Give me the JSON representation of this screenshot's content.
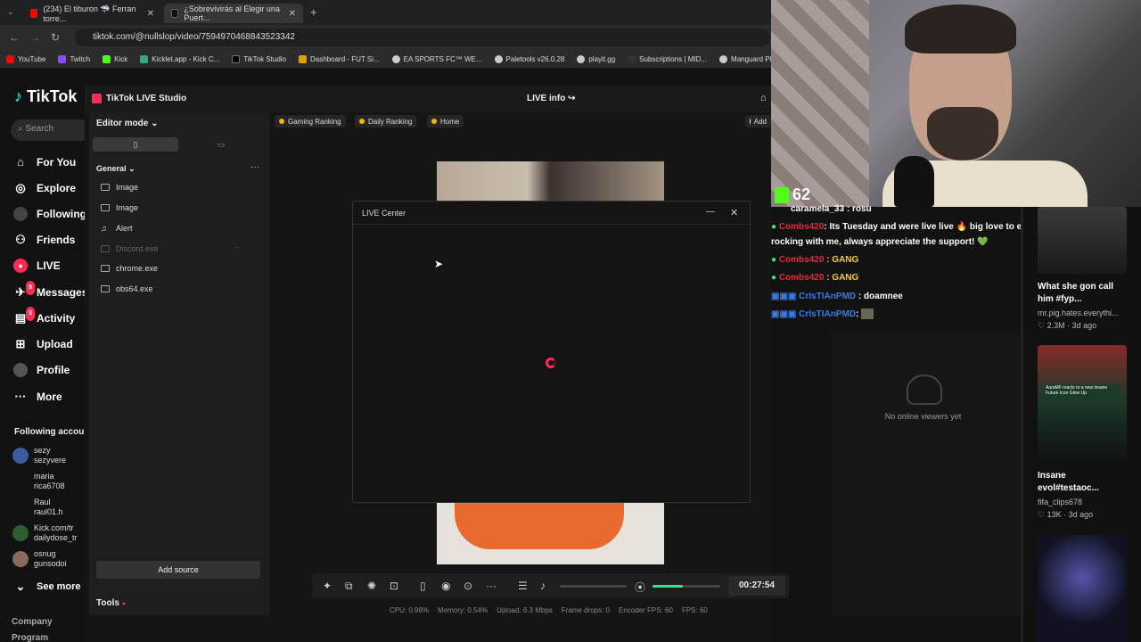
{
  "browser": {
    "tabs": [
      {
        "label": "(234) El tiburon 🦈 Ferran torre..."
      },
      {
        "label": "¿Sobrevivirás al Elegir una Puert..."
      }
    ],
    "url": "tiktok.com/@nullslop/video/7594970468843523342",
    "bookmarks": [
      "YouTube",
      "Twitch",
      "Kick",
      "Kicklet.app - Kick C...",
      "TikTok Studio",
      "Dashboard - FUT Si...",
      "EA SPORTS FC™ WE...",
      "Paletools v26.0.28",
      "playit.gg",
      "Subscriptions | MID...",
      "Manguard Plus"
    ]
  },
  "tiktok": {
    "logo": "TikTok",
    "search_placeholder": "Search",
    "nav": [
      {
        "label": "For You",
        "icon": "home-icon"
      },
      {
        "label": "Explore",
        "icon": "compass-icon"
      },
      {
        "label": "Following",
        "icon": "following-icon"
      },
      {
        "label": "Friends",
        "icon": "friends-icon"
      },
      {
        "label": "LIVE",
        "icon": "live-icon"
      },
      {
        "label": "Messages",
        "icon": "messages-icon",
        "badge": "9"
      },
      {
        "label": "Activity",
        "icon": "activity-icon",
        "badge": "3"
      },
      {
        "label": "Upload",
        "icon": "upload-icon"
      },
      {
        "label": "Profile",
        "icon": "profile-icon"
      },
      {
        "label": "More",
        "icon": "more-icon"
      }
    ],
    "following_header": "Following accoun",
    "following": [
      {
        "name": "sezy",
        "handle": "sezyvere"
      },
      {
        "name": "maria",
        "handle": "rica6708"
      },
      {
        "name": "Raul",
        "handle": "raul01.h"
      },
      {
        "name": "Kick.com/tr",
        "handle": "dailydose_tr"
      },
      {
        "name": "osnug",
        "handle": "gunsodoi"
      }
    ],
    "see_more": "See more",
    "footer": [
      "Company",
      "Program"
    ]
  },
  "studio": {
    "title": "TikTok LIVE Studio",
    "live_info": "LIVE info",
    "editor_mode": "Editor mode",
    "section": "General",
    "sources": [
      {
        "label": "Image",
        "dim": false
      },
      {
        "label": "Image",
        "dim": false
      },
      {
        "label": "Alert",
        "dim": false
      },
      {
        "label": "Discord.exe",
        "dim": true
      },
      {
        "label": "chrome.exe",
        "dim": false
      },
      {
        "label": "obs64.exe",
        "dim": false
      }
    ],
    "add_source": "Add source",
    "tools": "Tools",
    "pills": [
      "Gaming Ranking",
      "Daily Ranking",
      "Home"
    ],
    "add_label": "Add",
    "timer": "00:27:54",
    "volume_level": 0.45,
    "stats": {
      "cpu": "CPU: 0.98%",
      "memory": "Memory: 0.54%",
      "upload": "Upload: 6.3 Mbps",
      "frame_drops": "Frame drops: 0",
      "encoder_fps": "Encoder FPS: 60",
      "fps": "FPS: 60"
    }
  },
  "dialog": {
    "title": "LIVE Center"
  },
  "overlay": {
    "kick_count": "62"
  },
  "chat": [
    {
      "user": "caramela_33",
      "text": ": rosu",
      "color": "white"
    },
    {
      "user": "Combs420",
      "text": ": Its Tuesday and were live live 🔥 big love to everyone who's been",
      "color": "red"
    },
    {
      "user": "",
      "text": "rocking with me, always appreciate the support! 💚",
      "color": "white"
    },
    {
      "user": "Combs420",
      "text": ": GANG",
      "color": "red"
    },
    {
      "user": "Combs420",
      "text": ": GANG",
      "color": "red"
    },
    {
      "user": "CrIsTIAnPMD",
      "text": ": doamnee",
      "color": "blue"
    },
    {
      "user": "CrIsTIAnPMD",
      "text": ":",
      "color": "blue"
    }
  ],
  "viewers": {
    "empty": "No online viewers yet"
  },
  "feed": [
    {
      "title1": "What she gon call",
      "title2": "him #fyp...",
      "author": "mr.pig.hates.everythi...",
      "stats": "♡ 2.3M · 3d ago"
    },
    {
      "title1": "Insane",
      "title2": "evol#testaoc...",
      "author": "fifa_clips678",
      "stats": "♡ 13K · 3d ago"
    }
  ],
  "feed_thumb_text": "AuraMF reacts to a new insane Future Icon Glow Up"
}
